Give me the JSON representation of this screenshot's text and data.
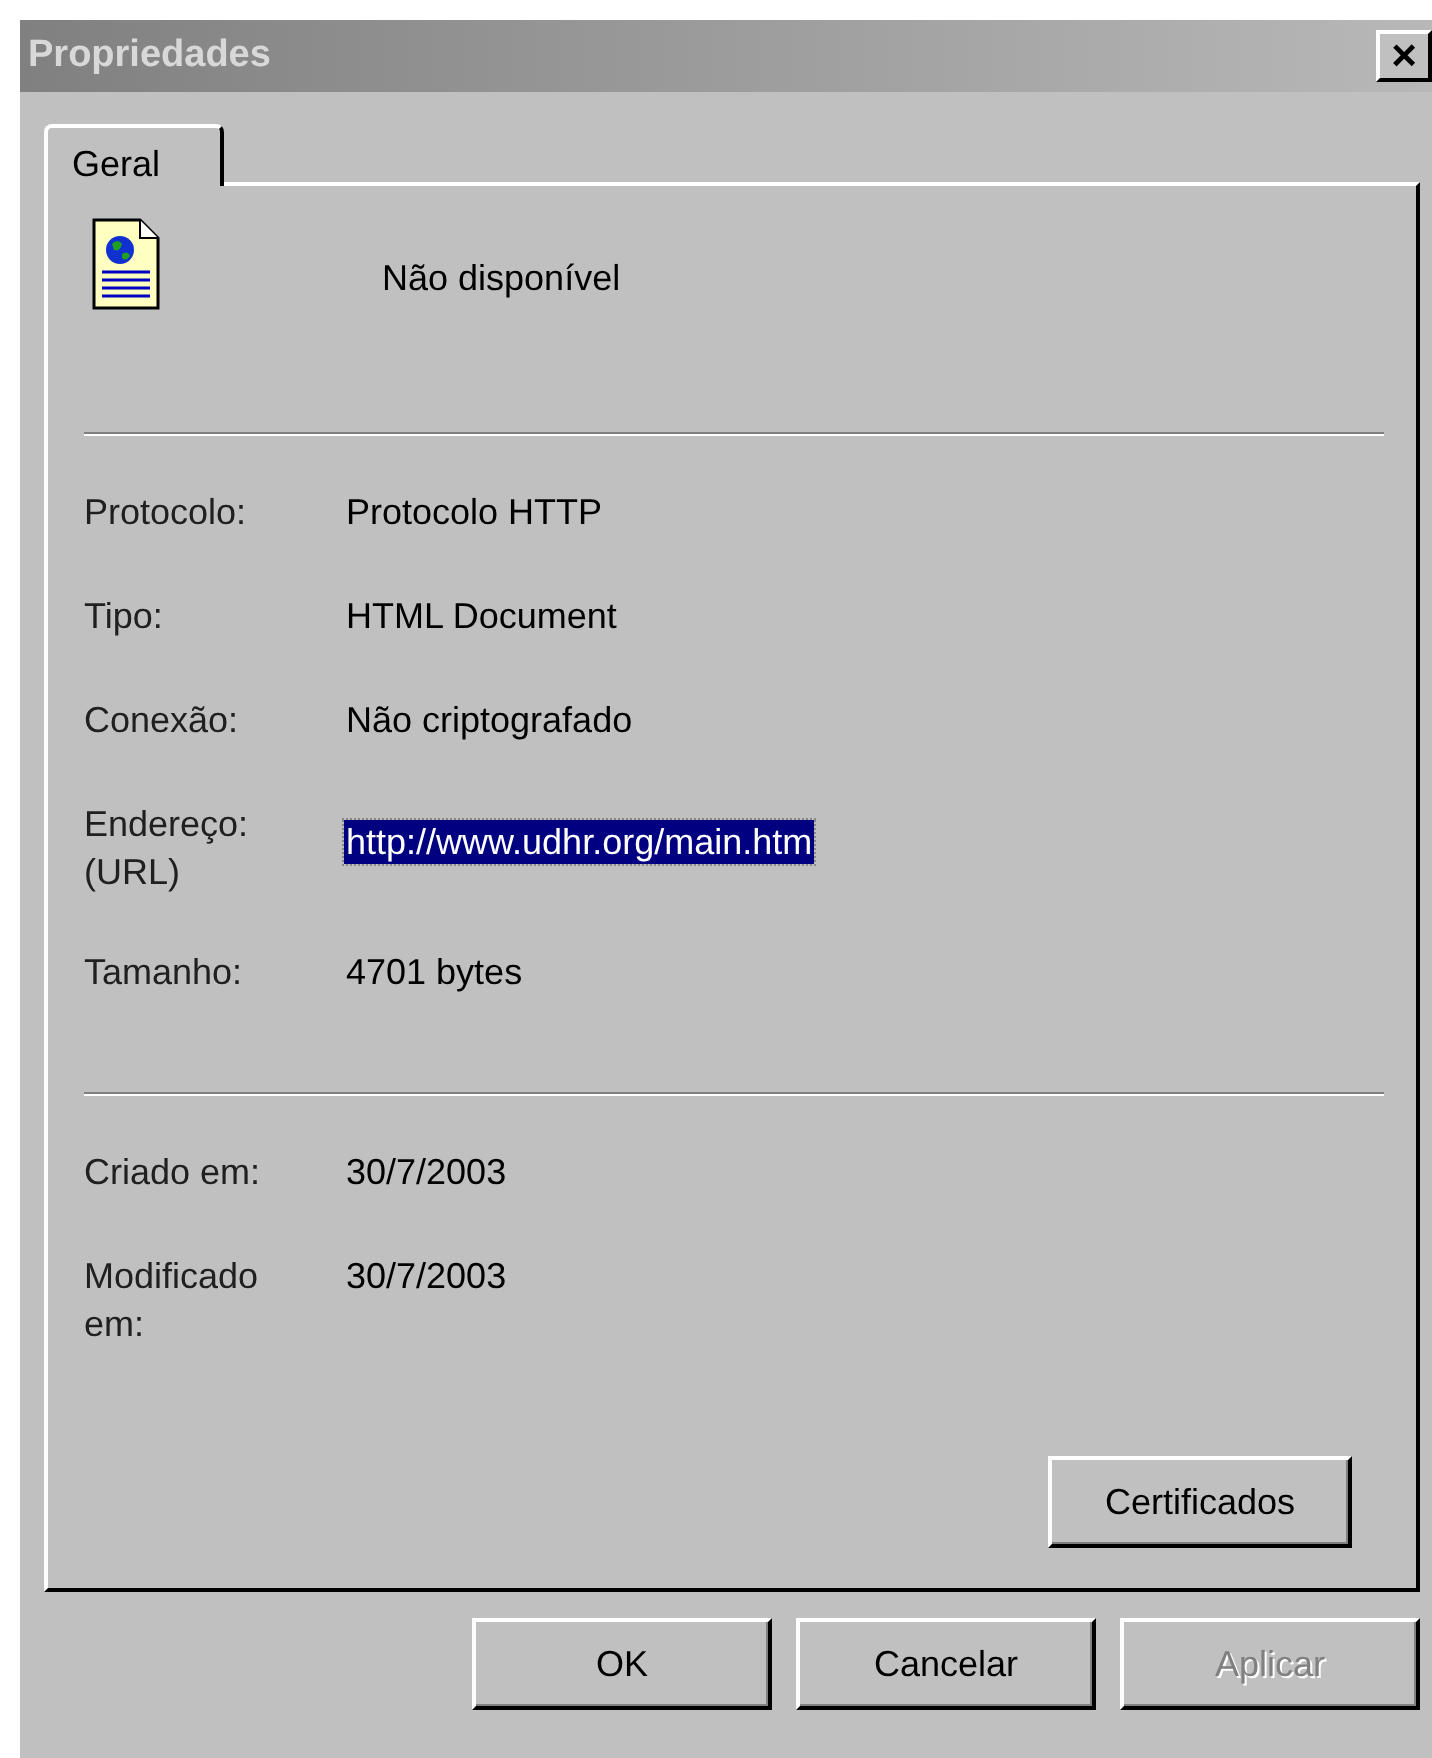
{
  "window": {
    "title": "Propriedades",
    "close": "×",
    "active": false
  },
  "tabs": [
    {
      "label": "Geral",
      "selected": true
    }
  ],
  "header": {
    "name": "Não disponível"
  },
  "sections": [
    {
      "rows": [
        {
          "label": "Protocolo:",
          "value": "Protocolo HTTP",
          "selected": false
        },
        {
          "label": "Tipo:",
          "value": "HTML Document",
          "selected": false
        },
        {
          "label": "Conexão:",
          "value": "Não criptografado",
          "selected": false
        },
        {
          "label": "Endereço:\n(URL)",
          "value": "http://www.udhr.org/main.htm",
          "selected": true
        },
        {
          "label": "Tamanho:",
          "value": "4701 bytes",
          "selected": false
        }
      ]
    },
    {
      "rows": [
        {
          "label": "Criado em:",
          "value": "30/7/2003",
          "selected": false
        },
        {
          "label": "Modificado\nem:",
          "value": "30/7/2003",
          "selected": false
        }
      ]
    }
  ],
  "panel_button": {
    "label": "Certificados",
    "disabled": false
  },
  "buttons": [
    {
      "label": "OK",
      "disabled": false
    },
    {
      "label": "Cancelar",
      "disabled": false
    },
    {
      "label": "Aplicar",
      "disabled": true
    }
  ]
}
